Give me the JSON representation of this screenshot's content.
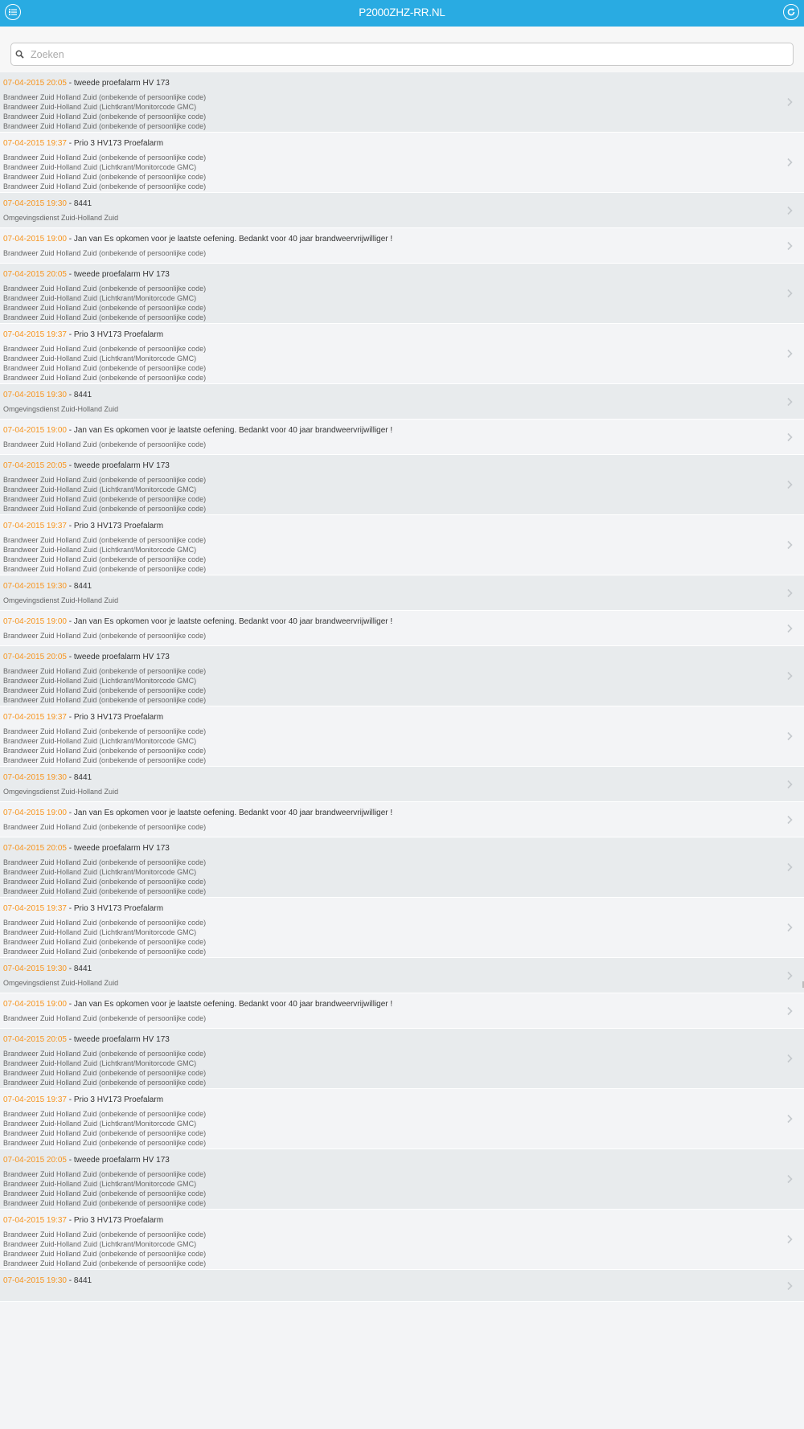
{
  "header": {
    "title": "P2000ZHZ-RR.NL"
  },
  "search": {
    "placeholder": "Zoeken"
  },
  "items": [
    {
      "time": "07-04-2015 20:05",
      "msg": "tweede proefalarm HV 173",
      "lines": [
        "Brandweer Zuid Holland Zuid (onbekende of persoonlijke code)",
        "Brandweer Zuid-Holland Zuid (Lichtkrant/Monitorcode GMC)",
        "Brandweer Zuid Holland Zuid (onbekende of persoonlijke code)",
        "Brandweer Zuid Holland Zuid (onbekende of persoonlijke code)"
      ]
    },
    {
      "time": "07-04-2015 19:37",
      "msg": "Prio 3 HV173 Proefalarm",
      "lines": [
        "Brandweer Zuid Holland Zuid (onbekende of persoonlijke code)",
        "Brandweer Zuid-Holland Zuid (Lichtkrant/Monitorcode GMC)",
        "Brandweer Zuid Holland Zuid (onbekende of persoonlijke code)",
        "Brandweer Zuid Holland Zuid (onbekende of persoonlijke code)"
      ]
    },
    {
      "time": "07-04-2015 19:30",
      "msg": "8441",
      "lines": [
        "Omgevingsdienst Zuid-Holland Zuid"
      ]
    },
    {
      "time": "07-04-2015 19:00",
      "msg": "Jan van Es opkomen voor je laatste oefening. Bedankt voor 40 jaar brandweervrijwilliger !",
      "lines": [
        "Brandweer Zuid Holland Zuid (onbekende of persoonlijke code)"
      ]
    },
    {
      "time": "07-04-2015 20:05",
      "msg": "tweede proefalarm HV 173",
      "lines": [
        "Brandweer Zuid Holland Zuid (onbekende of persoonlijke code)",
        "Brandweer Zuid-Holland Zuid (Lichtkrant/Monitorcode GMC)",
        "Brandweer Zuid Holland Zuid (onbekende of persoonlijke code)",
        "Brandweer Zuid Holland Zuid (onbekende of persoonlijke code)"
      ]
    },
    {
      "time": "07-04-2015 19:37",
      "msg": "Prio 3 HV173 Proefalarm",
      "lines": [
        "Brandweer Zuid Holland Zuid (onbekende of persoonlijke code)",
        "Brandweer Zuid-Holland Zuid (Lichtkrant/Monitorcode GMC)",
        "Brandweer Zuid Holland Zuid (onbekende of persoonlijke code)",
        "Brandweer Zuid Holland Zuid (onbekende of persoonlijke code)"
      ]
    },
    {
      "time": "07-04-2015 19:30",
      "msg": "8441",
      "lines": [
        "Omgevingsdienst Zuid-Holland Zuid"
      ]
    },
    {
      "time": "07-04-2015 19:00",
      "msg": "Jan van Es opkomen voor je laatste oefening. Bedankt voor 40 jaar brandweervrijwilliger !",
      "lines": [
        "Brandweer Zuid Holland Zuid (onbekende of persoonlijke code)"
      ]
    },
    {
      "time": "07-04-2015 20:05",
      "msg": "tweede proefalarm HV 173",
      "lines": [
        "Brandweer Zuid Holland Zuid (onbekende of persoonlijke code)",
        "Brandweer Zuid-Holland Zuid (Lichtkrant/Monitorcode GMC)",
        "Brandweer Zuid Holland Zuid (onbekende of persoonlijke code)",
        "Brandweer Zuid Holland Zuid (onbekende of persoonlijke code)"
      ]
    },
    {
      "time": "07-04-2015 19:37",
      "msg": "Prio 3 HV173 Proefalarm",
      "lines": [
        "Brandweer Zuid Holland Zuid (onbekende of persoonlijke code)",
        "Brandweer Zuid-Holland Zuid (Lichtkrant/Monitorcode GMC)",
        "Brandweer Zuid Holland Zuid (onbekende of persoonlijke code)",
        "Brandweer Zuid Holland Zuid (onbekende of persoonlijke code)"
      ]
    },
    {
      "time": "07-04-2015 19:30",
      "msg": "8441",
      "lines": [
        "Omgevingsdienst Zuid-Holland Zuid"
      ]
    },
    {
      "time": "07-04-2015 19:00",
      "msg": "Jan van Es opkomen voor je laatste oefening. Bedankt voor 40 jaar brandweervrijwilliger !",
      "lines": [
        "Brandweer Zuid Holland Zuid (onbekende of persoonlijke code)"
      ]
    },
    {
      "time": "07-04-2015 20:05",
      "msg": "tweede proefalarm HV 173",
      "lines": [
        "Brandweer Zuid Holland Zuid (onbekende of persoonlijke code)",
        "Brandweer Zuid-Holland Zuid (Lichtkrant/Monitorcode GMC)",
        "Brandweer Zuid Holland Zuid (onbekende of persoonlijke code)",
        "Brandweer Zuid Holland Zuid (onbekende of persoonlijke code)"
      ]
    },
    {
      "time": "07-04-2015 19:37",
      "msg": "Prio 3 HV173 Proefalarm",
      "lines": [
        "Brandweer Zuid Holland Zuid (onbekende of persoonlijke code)",
        "Brandweer Zuid-Holland Zuid (Lichtkrant/Monitorcode GMC)",
        "Brandweer Zuid Holland Zuid (onbekende of persoonlijke code)",
        "Brandweer Zuid Holland Zuid (onbekende of persoonlijke code)"
      ]
    },
    {
      "time": "07-04-2015 19:30",
      "msg": "8441",
      "lines": [
        "Omgevingsdienst Zuid-Holland Zuid"
      ]
    },
    {
      "time": "07-04-2015 19:00",
      "msg": "Jan van Es opkomen voor je laatste oefening. Bedankt voor 40 jaar brandweervrijwilliger !",
      "lines": [
        "Brandweer Zuid Holland Zuid (onbekende of persoonlijke code)"
      ]
    },
    {
      "time": "07-04-2015 20:05",
      "msg": "tweede proefalarm HV 173",
      "lines": [
        "Brandweer Zuid Holland Zuid (onbekende of persoonlijke code)",
        "Brandweer Zuid-Holland Zuid (Lichtkrant/Monitorcode GMC)",
        "Brandweer Zuid Holland Zuid (onbekende of persoonlijke code)",
        "Brandweer Zuid Holland Zuid (onbekende of persoonlijke code)"
      ]
    },
    {
      "time": "07-04-2015 19:37",
      "msg": "Prio 3 HV173 Proefalarm",
      "lines": [
        "Brandweer Zuid Holland Zuid (onbekende of persoonlijke code)",
        "Brandweer Zuid-Holland Zuid (Lichtkrant/Monitorcode GMC)",
        "Brandweer Zuid Holland Zuid (onbekende of persoonlijke code)",
        "Brandweer Zuid Holland Zuid (onbekende of persoonlijke code)"
      ]
    },
    {
      "time": "07-04-2015 19:30",
      "msg": "8441",
      "lines": [
        "Omgevingsdienst Zuid-Holland Zuid"
      ]
    },
    {
      "time": "07-04-2015 19:00",
      "msg": "Jan van Es opkomen voor je laatste oefening. Bedankt voor 40 jaar brandweervrijwilliger !",
      "lines": [
        "Brandweer Zuid Holland Zuid (onbekende of persoonlijke code)"
      ]
    },
    {
      "time": "07-04-2015 20:05",
      "msg": "tweede proefalarm HV 173",
      "lines": [
        "Brandweer Zuid Holland Zuid (onbekende of persoonlijke code)",
        "Brandweer Zuid-Holland Zuid (Lichtkrant/Monitorcode GMC)",
        "Brandweer Zuid Holland Zuid (onbekende of persoonlijke code)",
        "Brandweer Zuid Holland Zuid (onbekende of persoonlijke code)"
      ]
    },
    {
      "time": "07-04-2015 19:37",
      "msg": "Prio 3 HV173 Proefalarm",
      "lines": [
        "Brandweer Zuid Holland Zuid (onbekende of persoonlijke code)",
        "Brandweer Zuid-Holland Zuid (Lichtkrant/Monitorcode GMC)",
        "Brandweer Zuid Holland Zuid (onbekende of persoonlijke code)",
        "Brandweer Zuid Holland Zuid (onbekende of persoonlijke code)"
      ]
    },
    {
      "time": "07-04-2015 20:05",
      "msg": "tweede proefalarm HV 173",
      "lines": [
        "Brandweer Zuid Holland Zuid (onbekende of persoonlijke code)",
        "Brandweer Zuid-Holland Zuid (Lichtkrant/Monitorcode GMC)",
        "Brandweer Zuid Holland Zuid (onbekende of persoonlijke code)",
        "Brandweer Zuid Holland Zuid (onbekende of persoonlijke code)"
      ]
    },
    {
      "time": "07-04-2015 19:37",
      "msg": "Prio 3 HV173 Proefalarm",
      "lines": [
        "Brandweer Zuid Holland Zuid (onbekende of persoonlijke code)",
        "Brandweer Zuid-Holland Zuid (Lichtkrant/Monitorcode GMC)",
        "Brandweer Zuid Holland Zuid (onbekende of persoonlijke code)",
        "Brandweer Zuid Holland Zuid (onbekende of persoonlijke code)"
      ]
    },
    {
      "time": "07-04-2015 19:30",
      "msg": "8441",
      "lines": []
    }
  ],
  "colors": {
    "header": "#29abe2",
    "time": "#f7941d",
    "row_odd": "#e8ebed",
    "row_even": "#f3f4f6"
  },
  "icons": {
    "menu": "list-icon",
    "refresh": "refresh-icon",
    "search": "search-icon",
    "row": "chevron-right-icon"
  }
}
